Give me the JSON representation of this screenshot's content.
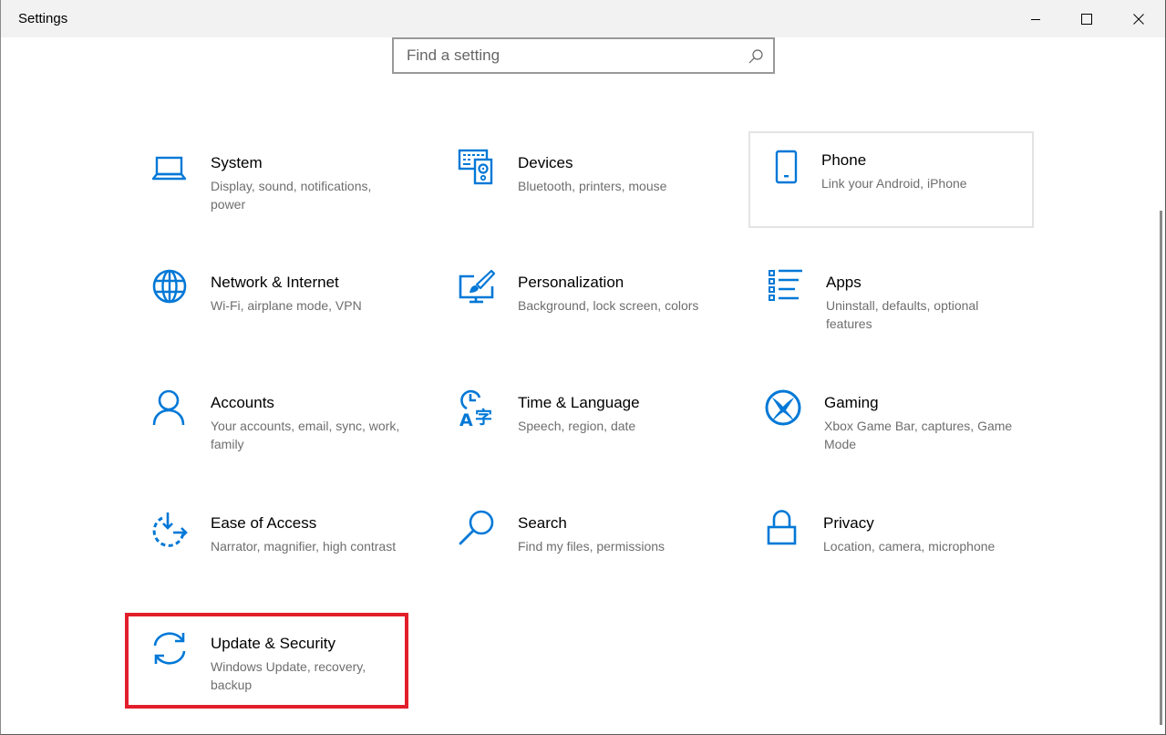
{
  "window": {
    "title": "Settings",
    "controls": {
      "minimize": "minimize-icon",
      "maximize": "maximize-icon",
      "close": "close-icon"
    }
  },
  "search": {
    "placeholder": "Find a setting",
    "value": "",
    "icon": "search-icon"
  },
  "accent_color": "#0078d7",
  "highlight_color": "#e31e2b",
  "tiles": [
    {
      "id": "system",
      "label": "System",
      "description": "Display, sound, notifications, power",
      "icon": "laptop-icon"
    },
    {
      "id": "devices",
      "label": "Devices",
      "description": "Bluetooth, printers, mouse",
      "icon": "keyboard-speaker-icon"
    },
    {
      "id": "phone",
      "label": "Phone",
      "description": "Link your Android, iPhone",
      "icon": "phone-icon"
    },
    {
      "id": "network",
      "label": "Network & Internet",
      "description": "Wi-Fi, airplane mode, VPN",
      "icon": "globe-icon"
    },
    {
      "id": "personalization",
      "label": "Personalization",
      "description": "Background, lock screen, colors",
      "icon": "paintbrush-monitor-icon"
    },
    {
      "id": "apps",
      "label": "Apps",
      "description": "Uninstall, defaults, optional features",
      "icon": "list-icon"
    },
    {
      "id": "accounts",
      "label": "Accounts",
      "description": "Your accounts, email, sync, work, family",
      "icon": "person-icon"
    },
    {
      "id": "time-language",
      "label": "Time & Language",
      "description": "Speech, region, date",
      "icon": "clock-language-icon"
    },
    {
      "id": "gaming",
      "label": "Gaming",
      "description": "Xbox Game Bar, captures, Game Mode",
      "icon": "xbox-icon"
    },
    {
      "id": "ease-of-access",
      "label": "Ease of Access",
      "description": "Narrator, magnifier, high contrast",
      "icon": "ease-of-access-icon"
    },
    {
      "id": "search",
      "label": "Search",
      "description": "Find my files, permissions",
      "icon": "magnifier-icon"
    },
    {
      "id": "privacy",
      "label": "Privacy",
      "description": "Location, camera, microphone",
      "icon": "lock-icon"
    },
    {
      "id": "update-security",
      "label": "Update & Security",
      "description": "Windows Update, recovery, backup",
      "icon": "sync-arrows-icon"
    }
  ],
  "hovered_tile": "phone",
  "highlighted_tile": "update-security"
}
